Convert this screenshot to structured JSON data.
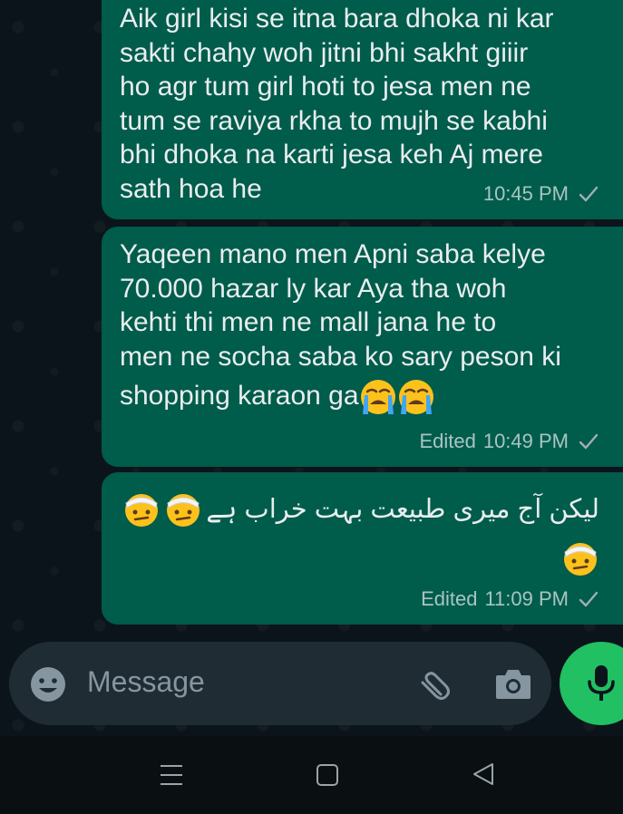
{
  "messages": [
    {
      "lines": [
        "Aik girl kisi se itna bara dhoka ni kar",
        "sakti chahy woh jitni bhi sakht giiir",
        "ho agr tum girl hoti to jesa men ne",
        "tum se raviya rkha to mujh se kabhi",
        "bhi dhoka na karti jesa keh Aj mere",
        "sath hoa he"
      ],
      "time": "10:45 PM",
      "edited": ""
    },
    {
      "lines": [
        "Yaqeen mano men Apni saba kelye",
        "70.000 hazar ly kar Aya tha woh",
        "kehti thi men ne mall jana he to",
        "men ne socha saba ko sary peson ki",
        "shopping karaon ga"
      ],
      "time": "10:49 PM",
      "edited": "Edited"
    },
    {
      "lines": [
        "لیکن آج میری طبیعت بہت خراب ہے"
      ],
      "time": "11:09 PM",
      "edited": "Edited"
    }
  ],
  "composer": {
    "placeholder": "Message"
  },
  "icons": {
    "emoji_btn": "smiley-icon",
    "attach": "paperclip-icon",
    "camera": "camera-icon",
    "mic": "microphone-icon",
    "crying": "loudly-crying-face-emoji",
    "bandage": "face-with-head-bandage-emoji",
    "read": "double-check-icon"
  },
  "colors": {
    "outgoing_bubble": "#005c4b",
    "background": "#0b141a",
    "composer": "#1f2c34",
    "mic_button": "#21c063"
  }
}
